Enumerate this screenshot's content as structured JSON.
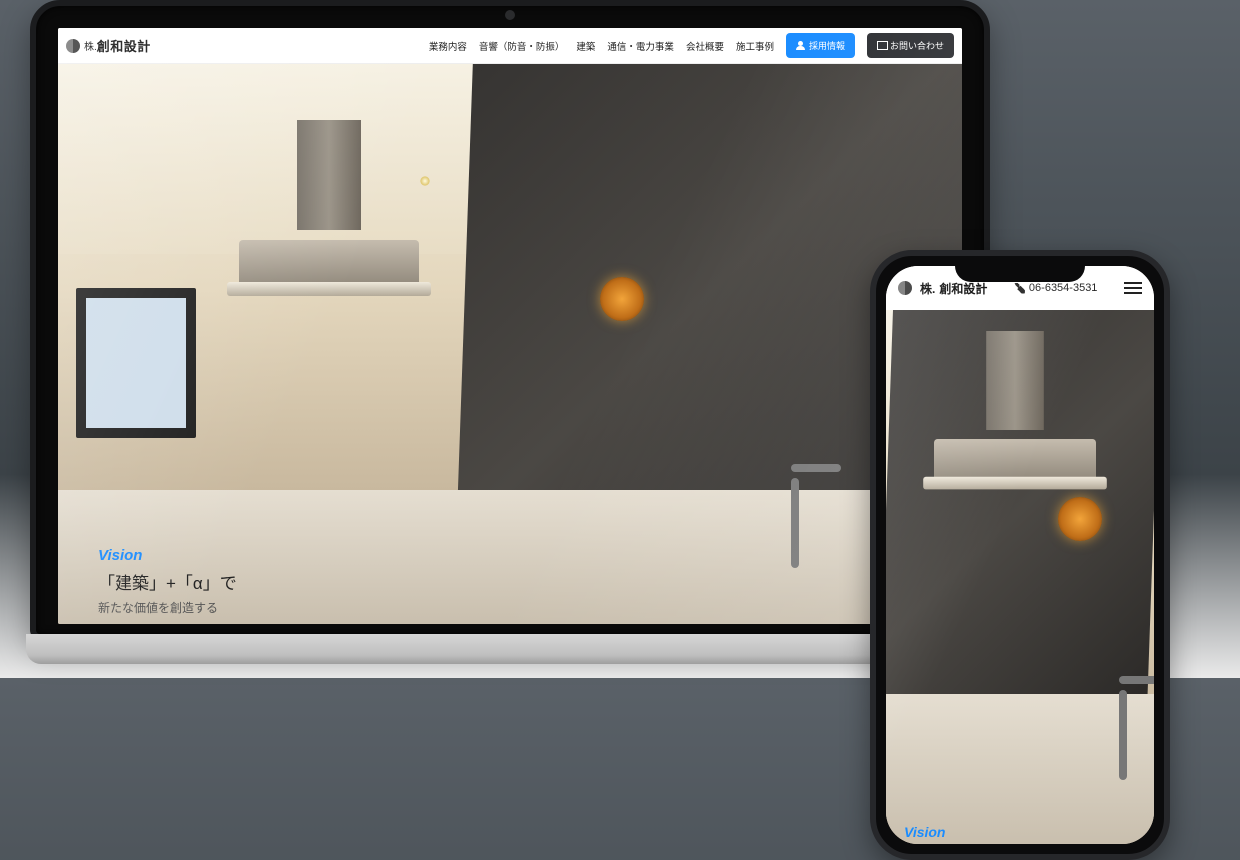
{
  "brand": {
    "prefix": "株.",
    "name": "創和設計"
  },
  "nav": {
    "items": [
      "業務内容",
      "音響（防音・防振）",
      "建築",
      "通信・電力事業",
      "会社概要",
      "施工事例"
    ]
  },
  "cta": {
    "recruit": "採用情報",
    "contact": "お問い合わせ"
  },
  "vision": {
    "label": "Vision",
    "headline": "「建築」+「α」で",
    "sub": "新たな価値を創造する"
  },
  "mobile": {
    "brand_prefix": "株.",
    "brand_name": "創和設計",
    "phone": "06-6354-3531",
    "vision_label": "Vision"
  },
  "colors": {
    "accent": "#1a8cff",
    "dark_button": "#2d2f33"
  }
}
